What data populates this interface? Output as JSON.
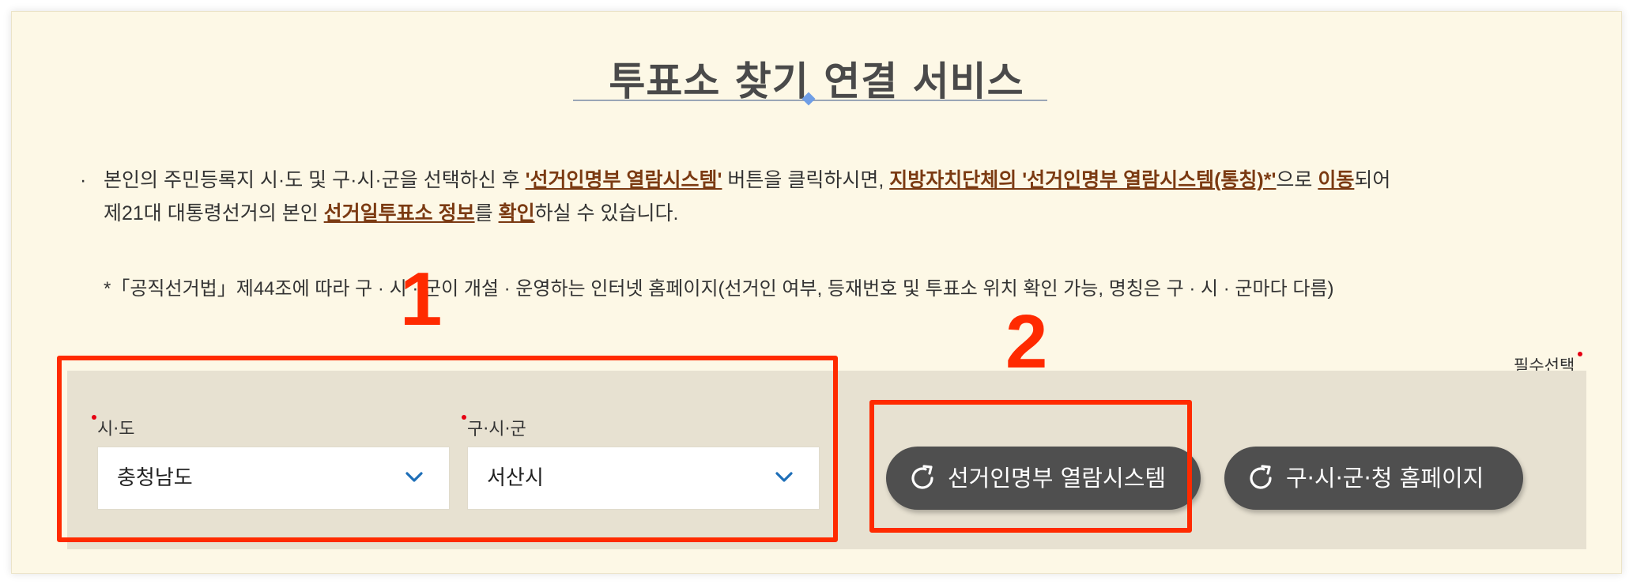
{
  "header": {
    "title": "투표소 찾기 연결 서비스"
  },
  "description": {
    "bullet": "·",
    "line1_part1": "본인의 주민등록지 시·도 및 구·시·군을 선택하신 후 ",
    "line1_em1": "'선거인명부 열람시스템'",
    "line1_part2": " 버튼을 클릭하시면, ",
    "line1_em2": "지방자치단체의 '선거인명부 열람시스템(통칭)*'",
    "line1_part3": "으로 ",
    "line1_em3": "이동",
    "line1_part4": "되어",
    "line2_part1": "제21대 대통령선거의 본인 ",
    "line2_em1": "선거일투표소 정보",
    "line2_part2": "를 ",
    "line2_em2": "확인",
    "line2_part3": "하실 수 있습니다.",
    "note": "*「공직선거법」제44조에 따라 구 · 시 · 군이 개설 · 운영하는 인터넷 홈페이지(선거인 여부, 등재번호 및 투표소 위치 확인 가능, 명칭은 구 · 시 · 군마다 다름)"
  },
  "required_label": "필수선택",
  "form": {
    "sido": {
      "label": "시·도",
      "value": "충청남도"
    },
    "gusigun": {
      "label": "구·시·군",
      "value": "서산시"
    }
  },
  "buttons": {
    "registry_label": "선거인명부 열람시스템",
    "homepage_label": "구·시·군·청 홈페이지"
  },
  "annotations": {
    "num1": "1",
    "num2": "2",
    "color": "#ff2a00"
  },
  "colors": {
    "panel_bg": "#fdf8e6",
    "select_area_bg": "#e7e1d1",
    "emphasis": "#7b3a12",
    "button_bg": "#4f4f4f",
    "chevron": "#1e6fb8",
    "required_dot": "#e60012"
  },
  "icons": {
    "title_ornament": "diamond-icon",
    "select_arrow": "chevron-down-icon",
    "button_icon": "external-link-refresh-icon"
  }
}
